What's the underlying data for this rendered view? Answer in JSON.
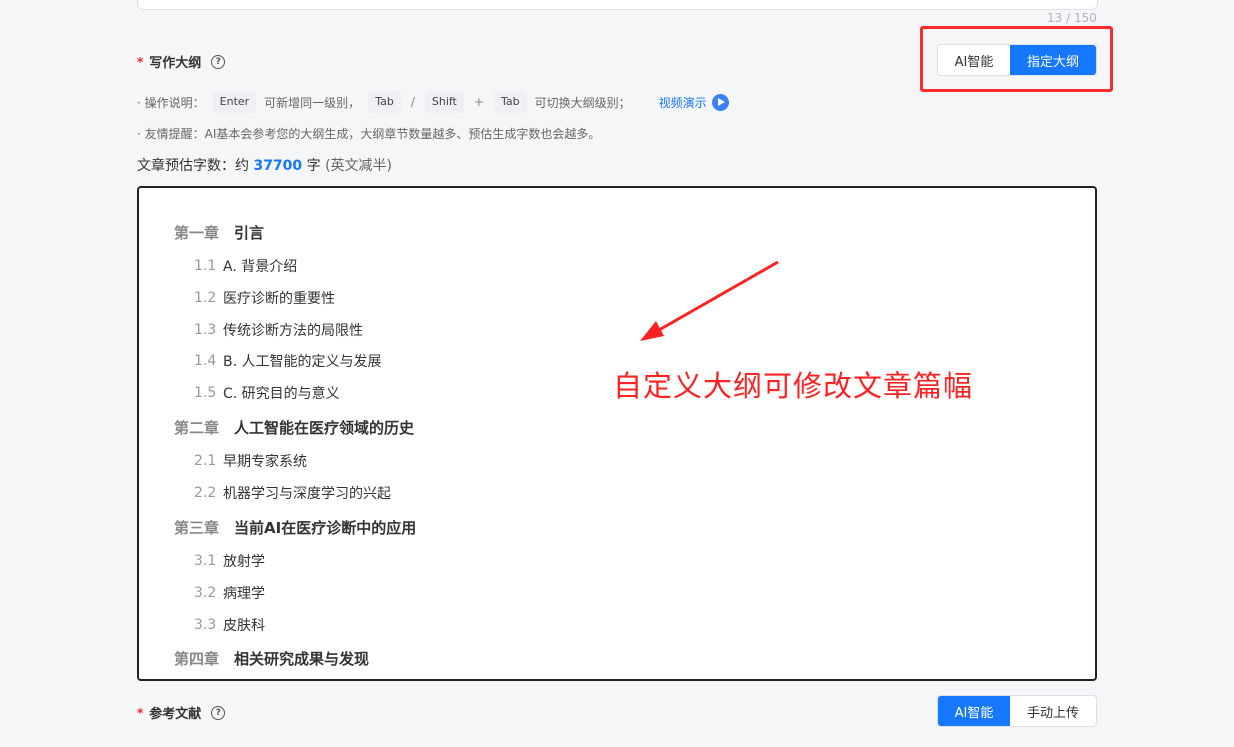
{
  "top": {
    "char_count": "13 / 150"
  },
  "outline_section": {
    "required_mark": "*",
    "label": "写作大纲",
    "help_icon": "question-circle-icon",
    "mode_options": [
      {
        "label": "AI智能",
        "active": false
      },
      {
        "label": "指定大纲",
        "active": true
      }
    ]
  },
  "instructions": {
    "prefix": "· 操作说明：",
    "key_enter": "Enter",
    "text_same_level": "可新增同一级别，",
    "key_tab": "Tab",
    "slash": "/",
    "key_shift": "Shift",
    "plus": "+",
    "key_tab2": "Tab",
    "text_switch_level": "可切换大纲级别；",
    "video_link": "视频演示",
    "video_icon": "play-circle-icon",
    "tip": "· 友情提醒：AI基本会参考您的大纲生成，大纲章节数量越多、预估生成字数也会越多。"
  },
  "estimate": {
    "prefix": "文章预估字数：约",
    "number": "37700",
    "unit": "字",
    "note": "(英文减半)"
  },
  "outline": {
    "chapters": [
      {
        "no": "第一章",
        "title": "引言",
        "sections": [
          {
            "no": "1.1",
            "title": "A. 背景介绍"
          },
          {
            "no": "1.2",
            "title": "医疗诊断的重要性"
          },
          {
            "no": "1.3",
            "title": "传统诊断方法的局限性"
          },
          {
            "no": "1.4",
            "title": "B. 人工智能的定义与发展"
          },
          {
            "no": "1.5",
            "title": "C. 研究目的与意义"
          }
        ]
      },
      {
        "no": "第二章",
        "title": "人工智能在医疗领域的历史",
        "sections": [
          {
            "no": "2.1",
            "title": "早期专家系统"
          },
          {
            "no": "2.2",
            "title": "机器学习与深度学习的兴起"
          }
        ]
      },
      {
        "no": "第三章",
        "title": "当前AI在医疗诊断中的应用",
        "sections": [
          {
            "no": "3.1",
            "title": "放射学"
          },
          {
            "no": "3.2",
            "title": "病理学"
          },
          {
            "no": "3.3",
            "title": "皮肤科"
          }
        ]
      },
      {
        "no": "第四章",
        "title": "相关研究成果与发现",
        "sections": []
      }
    ]
  },
  "annotation": {
    "text": "自定义大纲可修改文章篇幅",
    "color": "#ff2222"
  },
  "reference_section": {
    "required_mark": "*",
    "label": "参考文献",
    "help_icon": "question-circle-icon",
    "mode_options": [
      {
        "label": "AI智能",
        "active": true
      },
      {
        "label": "手动上传",
        "active": false
      }
    ]
  },
  "colors": {
    "accent": "#1677ff",
    "highlight": "#ff2b2b"
  }
}
